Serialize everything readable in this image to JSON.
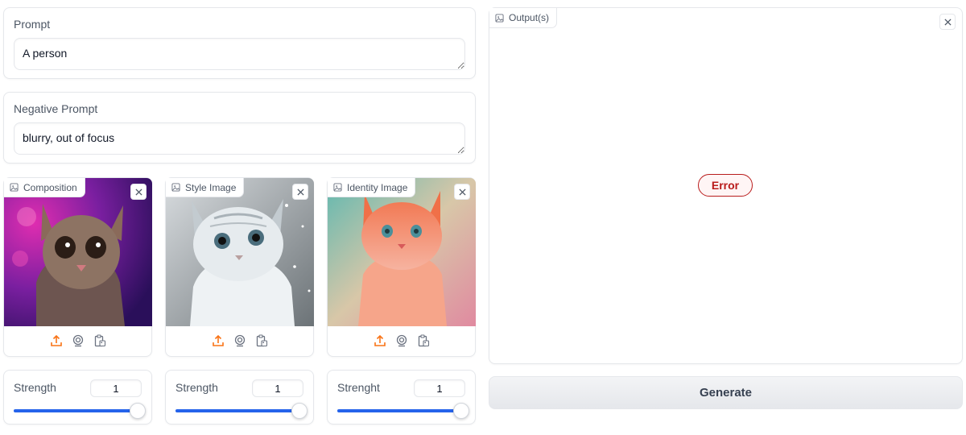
{
  "prompt": {
    "label": "Prompt",
    "value": "A person"
  },
  "negative_prompt": {
    "label": "Negative Prompt",
    "value": "blurry, out of focus"
  },
  "images": [
    {
      "label": "Composition",
      "icon": "image-icon"
    },
    {
      "label": "Style Image",
      "icon": "image-icon"
    },
    {
      "label": "Identity Image",
      "icon": "image-icon"
    }
  ],
  "image_tools": [
    "upload-icon",
    "webcam-icon",
    "clipboard-icon"
  ],
  "strengths": [
    {
      "label": "Strength",
      "value": "1",
      "fraction": 0.97
    },
    {
      "label": "Strength",
      "value": "1",
      "fraction": 0.97
    },
    {
      "label": "Strenght",
      "value": "1",
      "fraction": 0.97
    }
  ],
  "output": {
    "label": "Output(s)",
    "status": "Error"
  },
  "generate_label": "Generate",
  "colors": {
    "accent": "#2563eb",
    "upload": "#f97316",
    "error": "#b91c1c"
  }
}
